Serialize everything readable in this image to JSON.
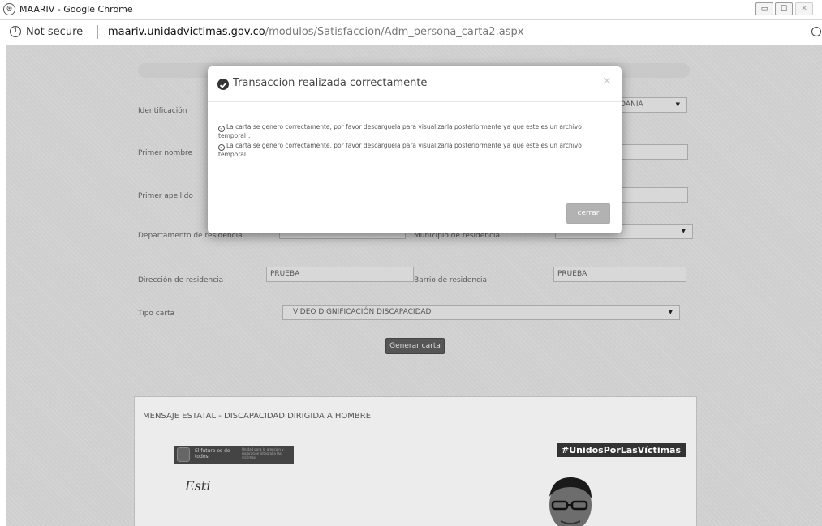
{
  "browser": {
    "window_title": "MAARIV - Google Chrome",
    "controls": {
      "minimize": "▭",
      "maximize": "☐",
      "close": "✕"
    },
    "security_label": "Not secure",
    "url_host": "maariv.unidadvictimas.gov.co",
    "url_path": "/modulos/Satisfaccion/Adm_persona_carta2.aspx"
  },
  "form": {
    "identificacion_label": "Identificación",
    "tipo_documento_value": "ADANIA",
    "primer_nombre_label": "Primer nombre",
    "primer_apellido_label": "Primer apellido",
    "departamento_label": "Departamento de residencia",
    "municipio_label": "Municipio de residencia",
    "direccion_label": "Dirección de residencia",
    "direccion_value": "PRUEBA",
    "barrio_label": "Barrio de residencia",
    "barrio_value": "PRUEBA",
    "tipo_carta_label": "Tipo carta",
    "tipo_carta_value": "VIDEO DIGNIFICACIÓN DISCAPACIDAD",
    "generar_button": "Generar carta"
  },
  "letter": {
    "title": "MENSAJE ESTATAL - DISCAPACIDAD DIRIGIDA A HOMBRE",
    "logo_text": "El futuro es de todos",
    "logo_subtext": "Unidad para la atención y reparación integral a las víctimas",
    "hashtag": "#UnidosPorLasVíctimas",
    "greeting": "Esti"
  },
  "modal": {
    "title": "Transaccion realizada correctamente",
    "close_symbol": "×",
    "messages": [
      "La carta se genero correctamente, por favor descarguela para visualizarla posteriormente ya que este es un archivo temporal!.",
      "La carta se genero correctamente, por favor descarguela para visualizarla posteriormente ya que este es un archivo temporal!."
    ],
    "cerrar_button": "cerrar"
  }
}
